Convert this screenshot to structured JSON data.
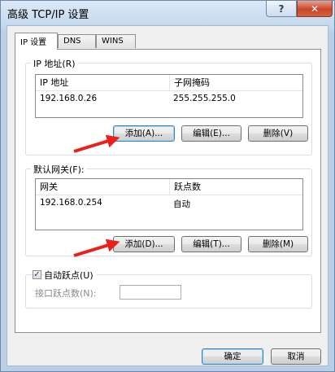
{
  "window": {
    "title": "高级 TCP/IP 设置",
    "help_glyph": "?",
    "close_glyph": "✕"
  },
  "tabs": [
    {
      "label": "IP 设置",
      "active": true
    },
    {
      "label": "DNS",
      "active": false
    },
    {
      "label": "WINS",
      "active": false
    }
  ],
  "ip_group": {
    "legend": "IP 地址(R)",
    "columns": [
      "IP 地址",
      "子网掩码"
    ],
    "rows": [
      {
        "ip": "192.168.0.26",
        "mask": "255.255.255.0"
      }
    ],
    "buttons": {
      "add": "添加(A)...",
      "edit": "编辑(E)...",
      "delete": "删除(V)"
    }
  },
  "gateway_group": {
    "legend": "默认网关(F):",
    "columns": [
      "网关",
      "跃点数"
    ],
    "rows": [
      {
        "gateway": "192.168.0.254",
        "metric": "自动"
      }
    ],
    "buttons": {
      "add": "添加(D)...",
      "edit": "编辑(T)...",
      "delete": "删除(M)"
    }
  },
  "metric_group": {
    "auto_label": "自动跃点(U)",
    "auto_checked": true,
    "check_glyph": "✓",
    "interface_label": "接口跃点数(N):",
    "interface_value": ""
  },
  "footer": {
    "ok": "确定",
    "cancel": "取消"
  },
  "colors": {
    "annotation_arrow": "#e8211b",
    "title_gradient_top": "#dbe9f7",
    "close_button": "#c8472a"
  }
}
